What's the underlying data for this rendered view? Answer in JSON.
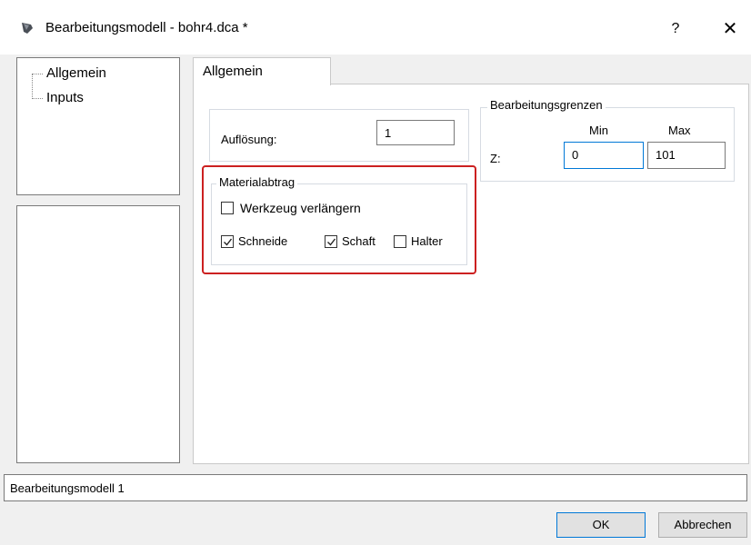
{
  "window": {
    "title": "Bearbeitungsmodell - bohr4.dca *",
    "help_glyph": "?",
    "close_glyph": "✕",
    "icon": "app-icon"
  },
  "tree": {
    "items": [
      {
        "label": "Allgemein"
      },
      {
        "label": "Inputs"
      }
    ]
  },
  "tab": {
    "label": "Allgemein"
  },
  "resolution": {
    "label": "Auflösung:",
    "value": "1"
  },
  "limits": {
    "group_label": "Bearbeitungsgrenzen",
    "min_header": "Min",
    "max_header": "Max",
    "z_label": "Z:",
    "z_min": "0",
    "z_max": "101"
  },
  "material": {
    "group_label": "Materialabtrag",
    "extend_tool": {
      "label": "Werkzeug verlängern",
      "checked": false
    },
    "cutter": {
      "label": "Schneide",
      "checked": true
    },
    "shank": {
      "label": "Schaft",
      "checked": true
    },
    "holder": {
      "label": "Halter",
      "checked": false
    }
  },
  "status": {
    "text": "Bearbeitungsmodell 1"
  },
  "buttons": {
    "ok": "OK",
    "cancel": "Abbrechen"
  },
  "colors": {
    "highlight": "#cc2020",
    "focus": "#0078d7"
  }
}
